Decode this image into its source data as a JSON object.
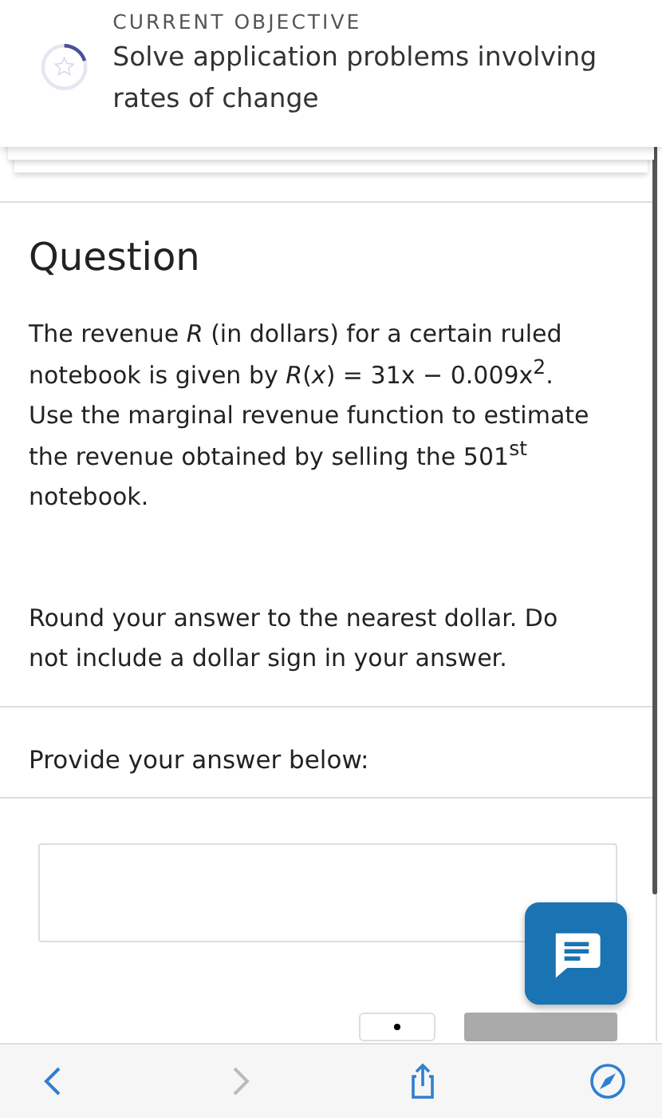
{
  "objective": {
    "label": "CURRENT OBJECTIVE",
    "title": "Solve application problems involving rates of change",
    "progress": {
      "level": 0.2
    }
  },
  "question": {
    "heading": "Question",
    "body": "The revenue *R* (in dollars) for a certain ruled notebook is given by *R*(*x*) = 31x − 0.009x$^{2}$. Use the marginal revenue function to estimate the revenue obtained by selling the 501$^{st}$ notebook.",
    "instruction": "Round your answer to the nearest dollar. Do not include a dollar sign in your answer.",
    "prompt": "Provide your answer below:"
  },
  "submit": {
    "disabled": true
  },
  "browser_bar": {
    "back_disabled": false,
    "forward_disabled": true
  }
}
